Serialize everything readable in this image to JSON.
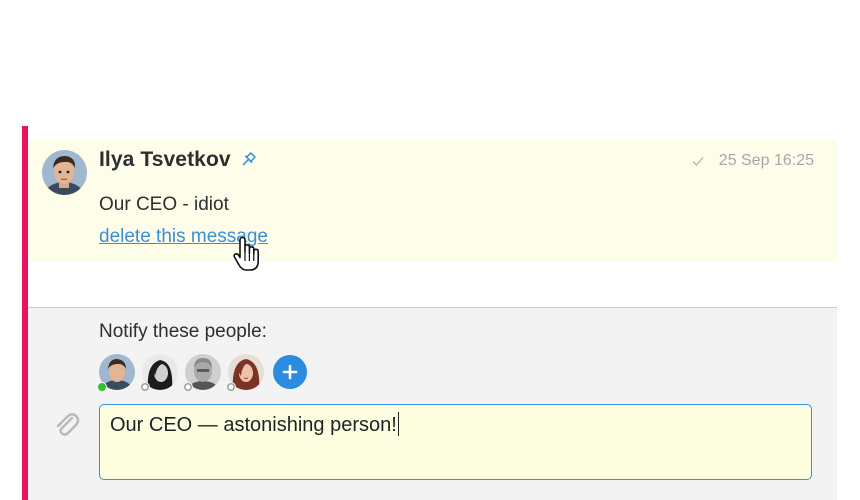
{
  "message": {
    "author": "Ilya Tsvetkov",
    "time": "25 Sep 16:25",
    "text": "Our CEO - idiot",
    "delete_link": "delete this message"
  },
  "compose": {
    "notify_label": "Notify these people:",
    "people": [
      {
        "avatar": "avatar-man-1",
        "status": "online"
      },
      {
        "avatar": "avatar-woman-1",
        "status": "offline"
      },
      {
        "avatar": "avatar-man-2",
        "status": "offline"
      },
      {
        "avatar": "avatar-woman-2",
        "status": "offline"
      }
    ],
    "input_value": "Our CEO — astonishing person!"
  },
  "icons": {
    "pin": "pin-icon",
    "read_receipt": "check-icon",
    "add_person": "plus-icon",
    "attach": "paperclip-icon",
    "cursor": "hand-pointer-icon"
  },
  "colors": {
    "accent_bar": "#e8145f",
    "message_bg": "#fdfde9",
    "link": "#3a8fd9",
    "add_button": "#2a8be0",
    "online": "#2ec32e",
    "input_border": "#3d8fda"
  }
}
